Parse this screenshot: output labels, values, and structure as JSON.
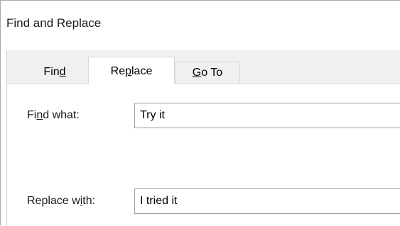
{
  "dialog": {
    "title": "Find and Replace"
  },
  "tabs": [
    {
      "label_pre": "Fin",
      "label_key": "d",
      "label_post": "",
      "active": false
    },
    {
      "label_pre": "Re",
      "label_key": "p",
      "label_post": "lace",
      "active": true
    },
    {
      "label_pre": "",
      "label_key": "G",
      "label_post": "o To",
      "active": false
    }
  ],
  "find": {
    "label_pre": "Fi",
    "label_key": "n",
    "label_post": "d what:",
    "value": "Try it"
  },
  "replace": {
    "label_pre": "Replace w",
    "label_key": "i",
    "label_post": "th:",
    "value": "I tried it"
  },
  "colors": {
    "dialog_bg": "#f0f0f0",
    "panel_bg": "#ffffff",
    "border": "#a0a0a0"
  }
}
